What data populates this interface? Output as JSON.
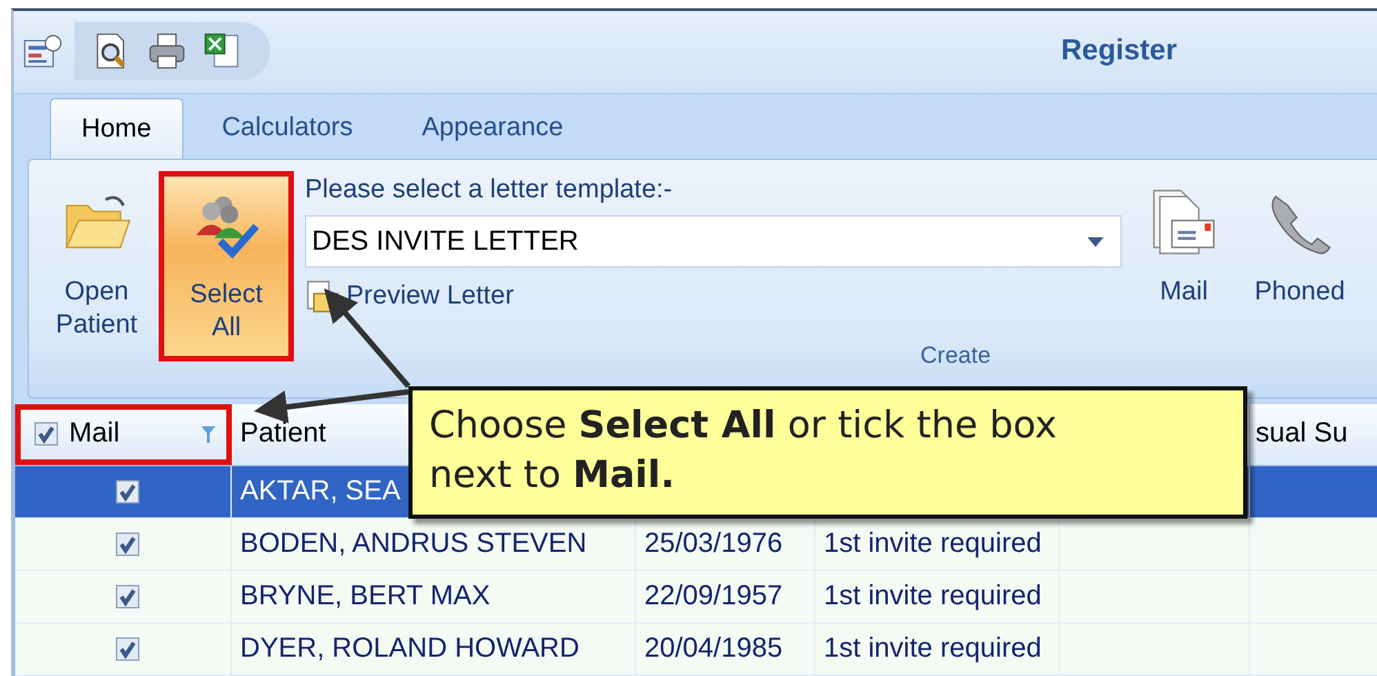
{
  "window": {
    "title": "Register"
  },
  "tabs": [
    {
      "label": "Home",
      "selected": true
    },
    {
      "label": "Calculators",
      "selected": false
    },
    {
      "label": "Appearance",
      "selected": false
    }
  ],
  "ribbon": {
    "open_patient": {
      "label": "Open Patient",
      "highlighted": false
    },
    "select_all": {
      "label": "Select All",
      "highlighted": true
    },
    "template_label": "Please select a letter template:-",
    "template_value": "DES INVITE LETTER",
    "preview": "Preview Letter",
    "mail": "Mail",
    "phoned": "Phoned",
    "group_label": "Create"
  },
  "table": {
    "header": {
      "mail_label": "Mail",
      "mail_checked": true,
      "mail_highlighted": true,
      "patient_label": "Patient",
      "last_label": "sual Su"
    },
    "rows": [
      {
        "mail_checked": true,
        "patient": "AKTAR, SEA",
        "selected": true
      },
      {
        "mail_checked": true,
        "patient": "BODEN, ANDRUS STEVEN",
        "dob": "25/03/1976",
        "status": "1st invite required",
        "selected": false
      },
      {
        "mail_checked": true,
        "patient": "BRYNE, BERT MAX",
        "dob": "22/09/1957",
        "status": "1st invite required",
        "selected": false
      },
      {
        "mail_checked": true,
        "patient": "DYER, ROLAND HOWARD",
        "dob": "20/04/1985",
        "status": "1st invite required",
        "selected": false
      }
    ]
  },
  "callout": {
    "lines": [
      "Choose **Select All** or tick the box",
      "next to **Mail.**"
    ]
  }
}
